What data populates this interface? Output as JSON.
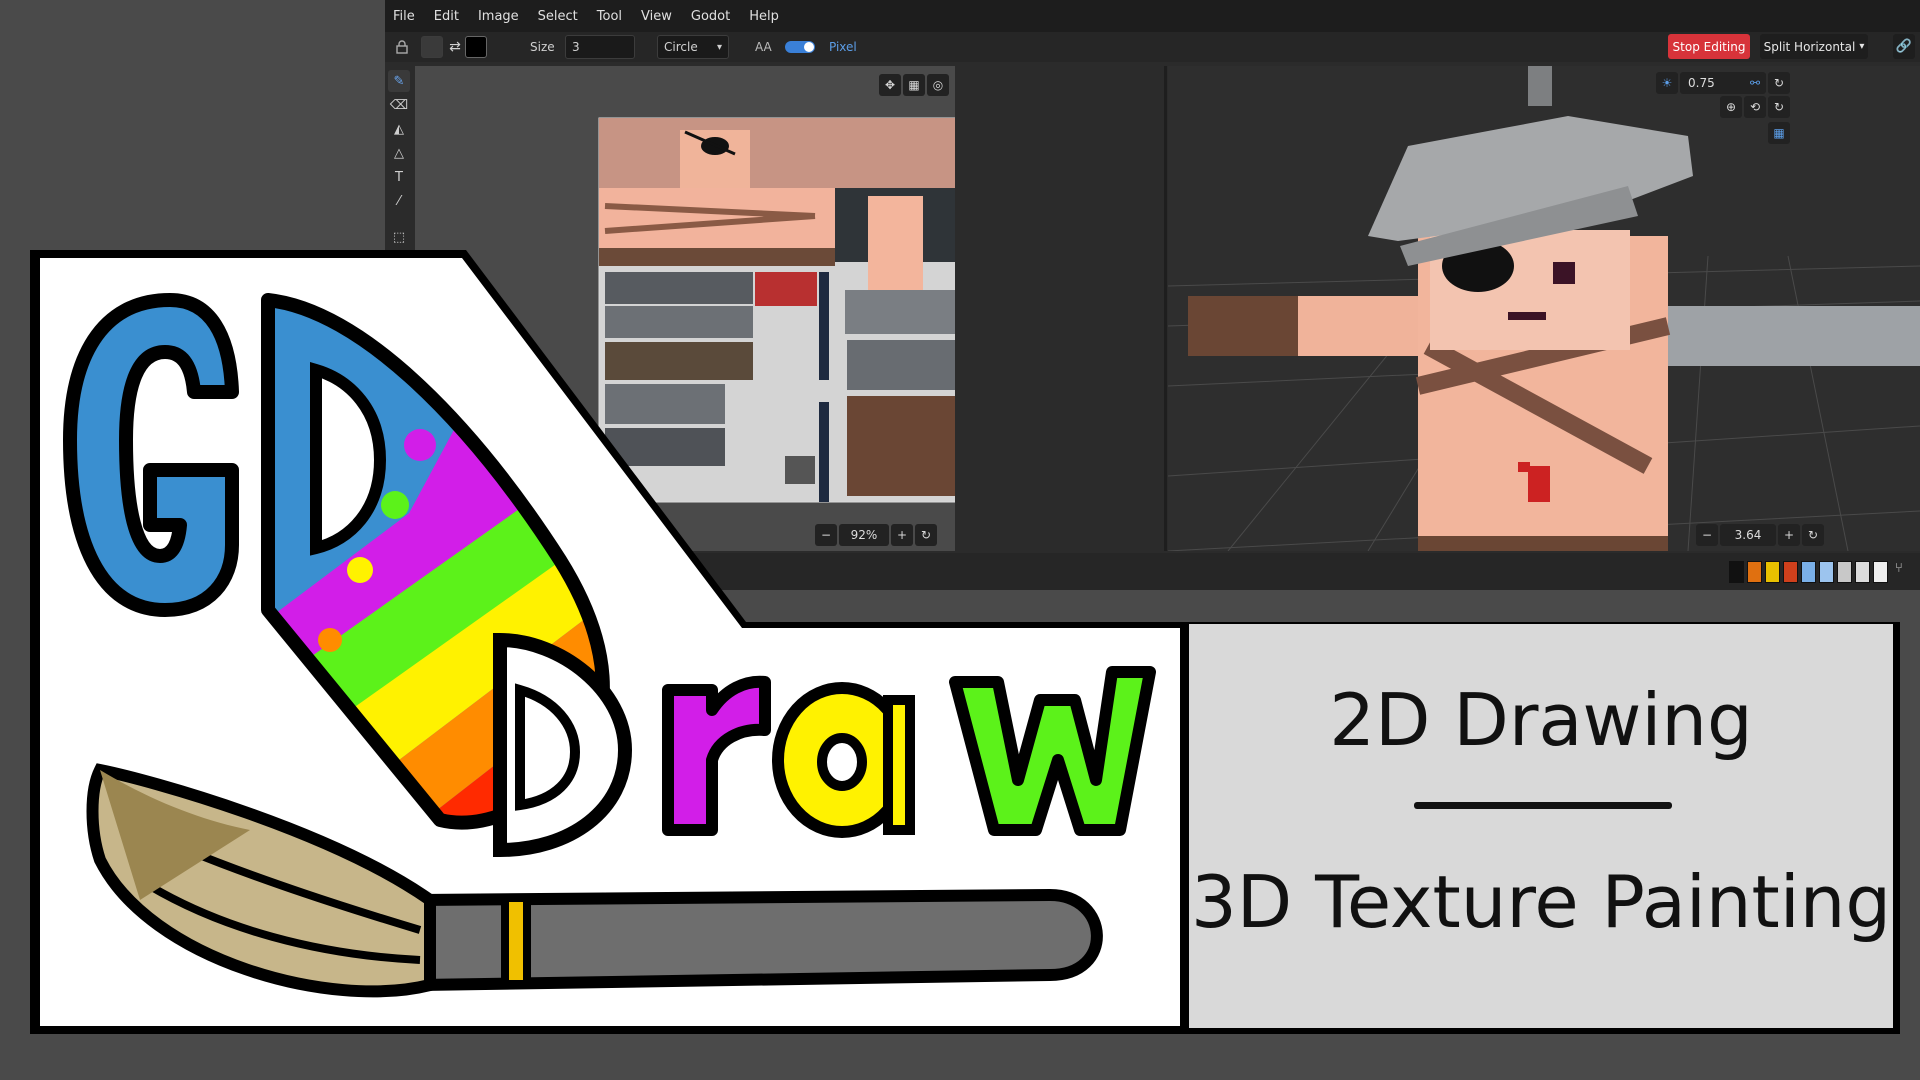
{
  "menu": [
    "File",
    "Edit",
    "Image",
    "Select",
    "Tool",
    "View",
    "Godot",
    "Help"
  ],
  "toolbar": {
    "size_label": "Size",
    "size_value": "3",
    "shape_value": "Circle",
    "aa_label": "AA",
    "pixel_label": "Pixel",
    "stop_editing": "Stop Editing",
    "split_mode": "Split Horizontal"
  },
  "viewport2d": {
    "zoom": "92%"
  },
  "viewport3d": {
    "light_value": "0.75",
    "zoom": "3.64"
  },
  "palette": [
    "#111111",
    "#e07010",
    "#e8c000",
    "#d0401c",
    "#7ab0e8",
    "#9cc4ee",
    "#c8c8c8",
    "#dcdcdc",
    "#eeeeee"
  ],
  "logo": {
    "word1": "GD",
    "word2": "Draw"
  },
  "info": {
    "line1": "2D Drawing",
    "line2": "3D Texture Painting"
  },
  "icons": {
    "menu_toggle": "lock-icon",
    "swap": "swap-icon",
    "move": "move-icon",
    "grid": "grid-icon",
    "pencil": "pencil-icon",
    "eraser": "eraser-icon",
    "bucket": "bucket-icon",
    "zoom_in": "zoom-in-icon",
    "zoom_out": "zoom-out-icon",
    "reset": "reset-icon",
    "link": "link-icon"
  },
  "colors": {
    "accent": "#4a8fe0",
    "stop": "#d7333a",
    "logo_blue": "#3a8fd0",
    "logo_purple": "#d21ee8",
    "logo_yellow": "#fff200",
    "logo_green": "#5cf21a"
  }
}
